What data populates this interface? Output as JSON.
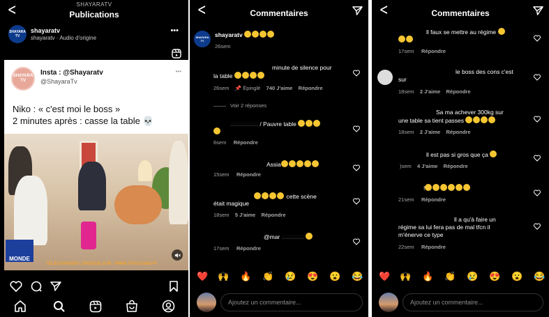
{
  "colors": {
    "bg": "#000000",
    "accent_blue": "#0d3b8c",
    "muted": "#8e8e8e"
  },
  "panel1": {
    "header_subtitle": "SHAYARATV",
    "header_title": "Publications",
    "post_user": "shayaratv",
    "post_audio": "shayaratv · Audio d'origine",
    "more": "•••",
    "card_name": "Insta : @Shayaratv",
    "card_handle": "@ShayaraTv",
    "card_line1": "Niko : « c'est moi le boss »",
    "card_line2": "2 minutes après : casse la table 💀",
    "card_dots": "•••",
    "watermark_left": "MONDE",
    "watermark_right": "TÉLÉCHARGER L'ÉPISODE SUR : WWW.TRACKS88.FR",
    "avatar_text": "SHAYARA TV",
    "tab_icons": [
      "home-icon",
      "search-icon",
      "reels-icon",
      "shop-icon",
      "profile-icon"
    ]
  },
  "panel2": {
    "header_title": "Commentaires",
    "comments": [
      {
        "text": "shayaratv",
        "time": "26sem"
      },
      {
        "text_line1": "minute de silence pour",
        "text_line2": "la table",
        "time": "26sem",
        "pinned": "Épinglé",
        "likes": "740 J'aime",
        "reply": "Répondre"
      },
      {
        "view_replies": "Voir 2 réponses"
      },
      {
        "text": "/ Pauvre table",
        "time": "6sem",
        "reply": "Répondre"
      },
      {
        "text": "Assia",
        "time": "15sem",
        "reply": "Répondre"
      },
      {
        "text_line1": "cette scène",
        "text_line2": "était magique",
        "time": "18sem",
        "likes": "5 J'aime",
        "reply": "Répondre"
      },
      {
        "text": "@mar",
        "time": "17sem",
        "reply": "Répondre"
      }
    ],
    "emojis": [
      "❤️",
      "🙌",
      "🔥",
      "👏",
      "😢",
      "😍",
      "😮",
      "😂"
    ],
    "add_placeholder": "Ajoutez un commentaire..."
  },
  "panel3": {
    "header_title": "Commentaires",
    "comments": [
      {
        "text": "ll faux se mettre au régime",
        "time": "17sem",
        "reply": "Répondre"
      },
      {
        "text_line1": "le boss des cons c'est",
        "text_line2": "sur",
        "time": "18sem",
        "likes": "2 J'aime",
        "reply": "Répondre"
      },
      {
        "text_line1": "Sa ma achever 300kg sur",
        "text_line2": "une table sa tient passes",
        "time": "18sem",
        "likes": "2 J'aime",
        "reply": "Répondre"
      },
      {
        "text": "ll est pas si gros que ça",
        "time": ")sem",
        "likes": "4 J'aime",
        "reply": "Répondre"
      },
      {
        "text": "!",
        "time": "21sem",
        "reply": "Répondre"
      },
      {
        "text_line1": "ll a qu'à faire un",
        "text_line2": "régime sa lui fera pas de mal tfcn il",
        "text_line3": "m'énerve ce type",
        "time": "22sem",
        "reply": "Répondre"
      }
    ],
    "emojis": [
      "❤️",
      "🙌",
      "🔥",
      "👏",
      "😢",
      "😍",
      "😮",
      "😂"
    ],
    "add_placeholder": "Ajoutez un commentaire..."
  }
}
